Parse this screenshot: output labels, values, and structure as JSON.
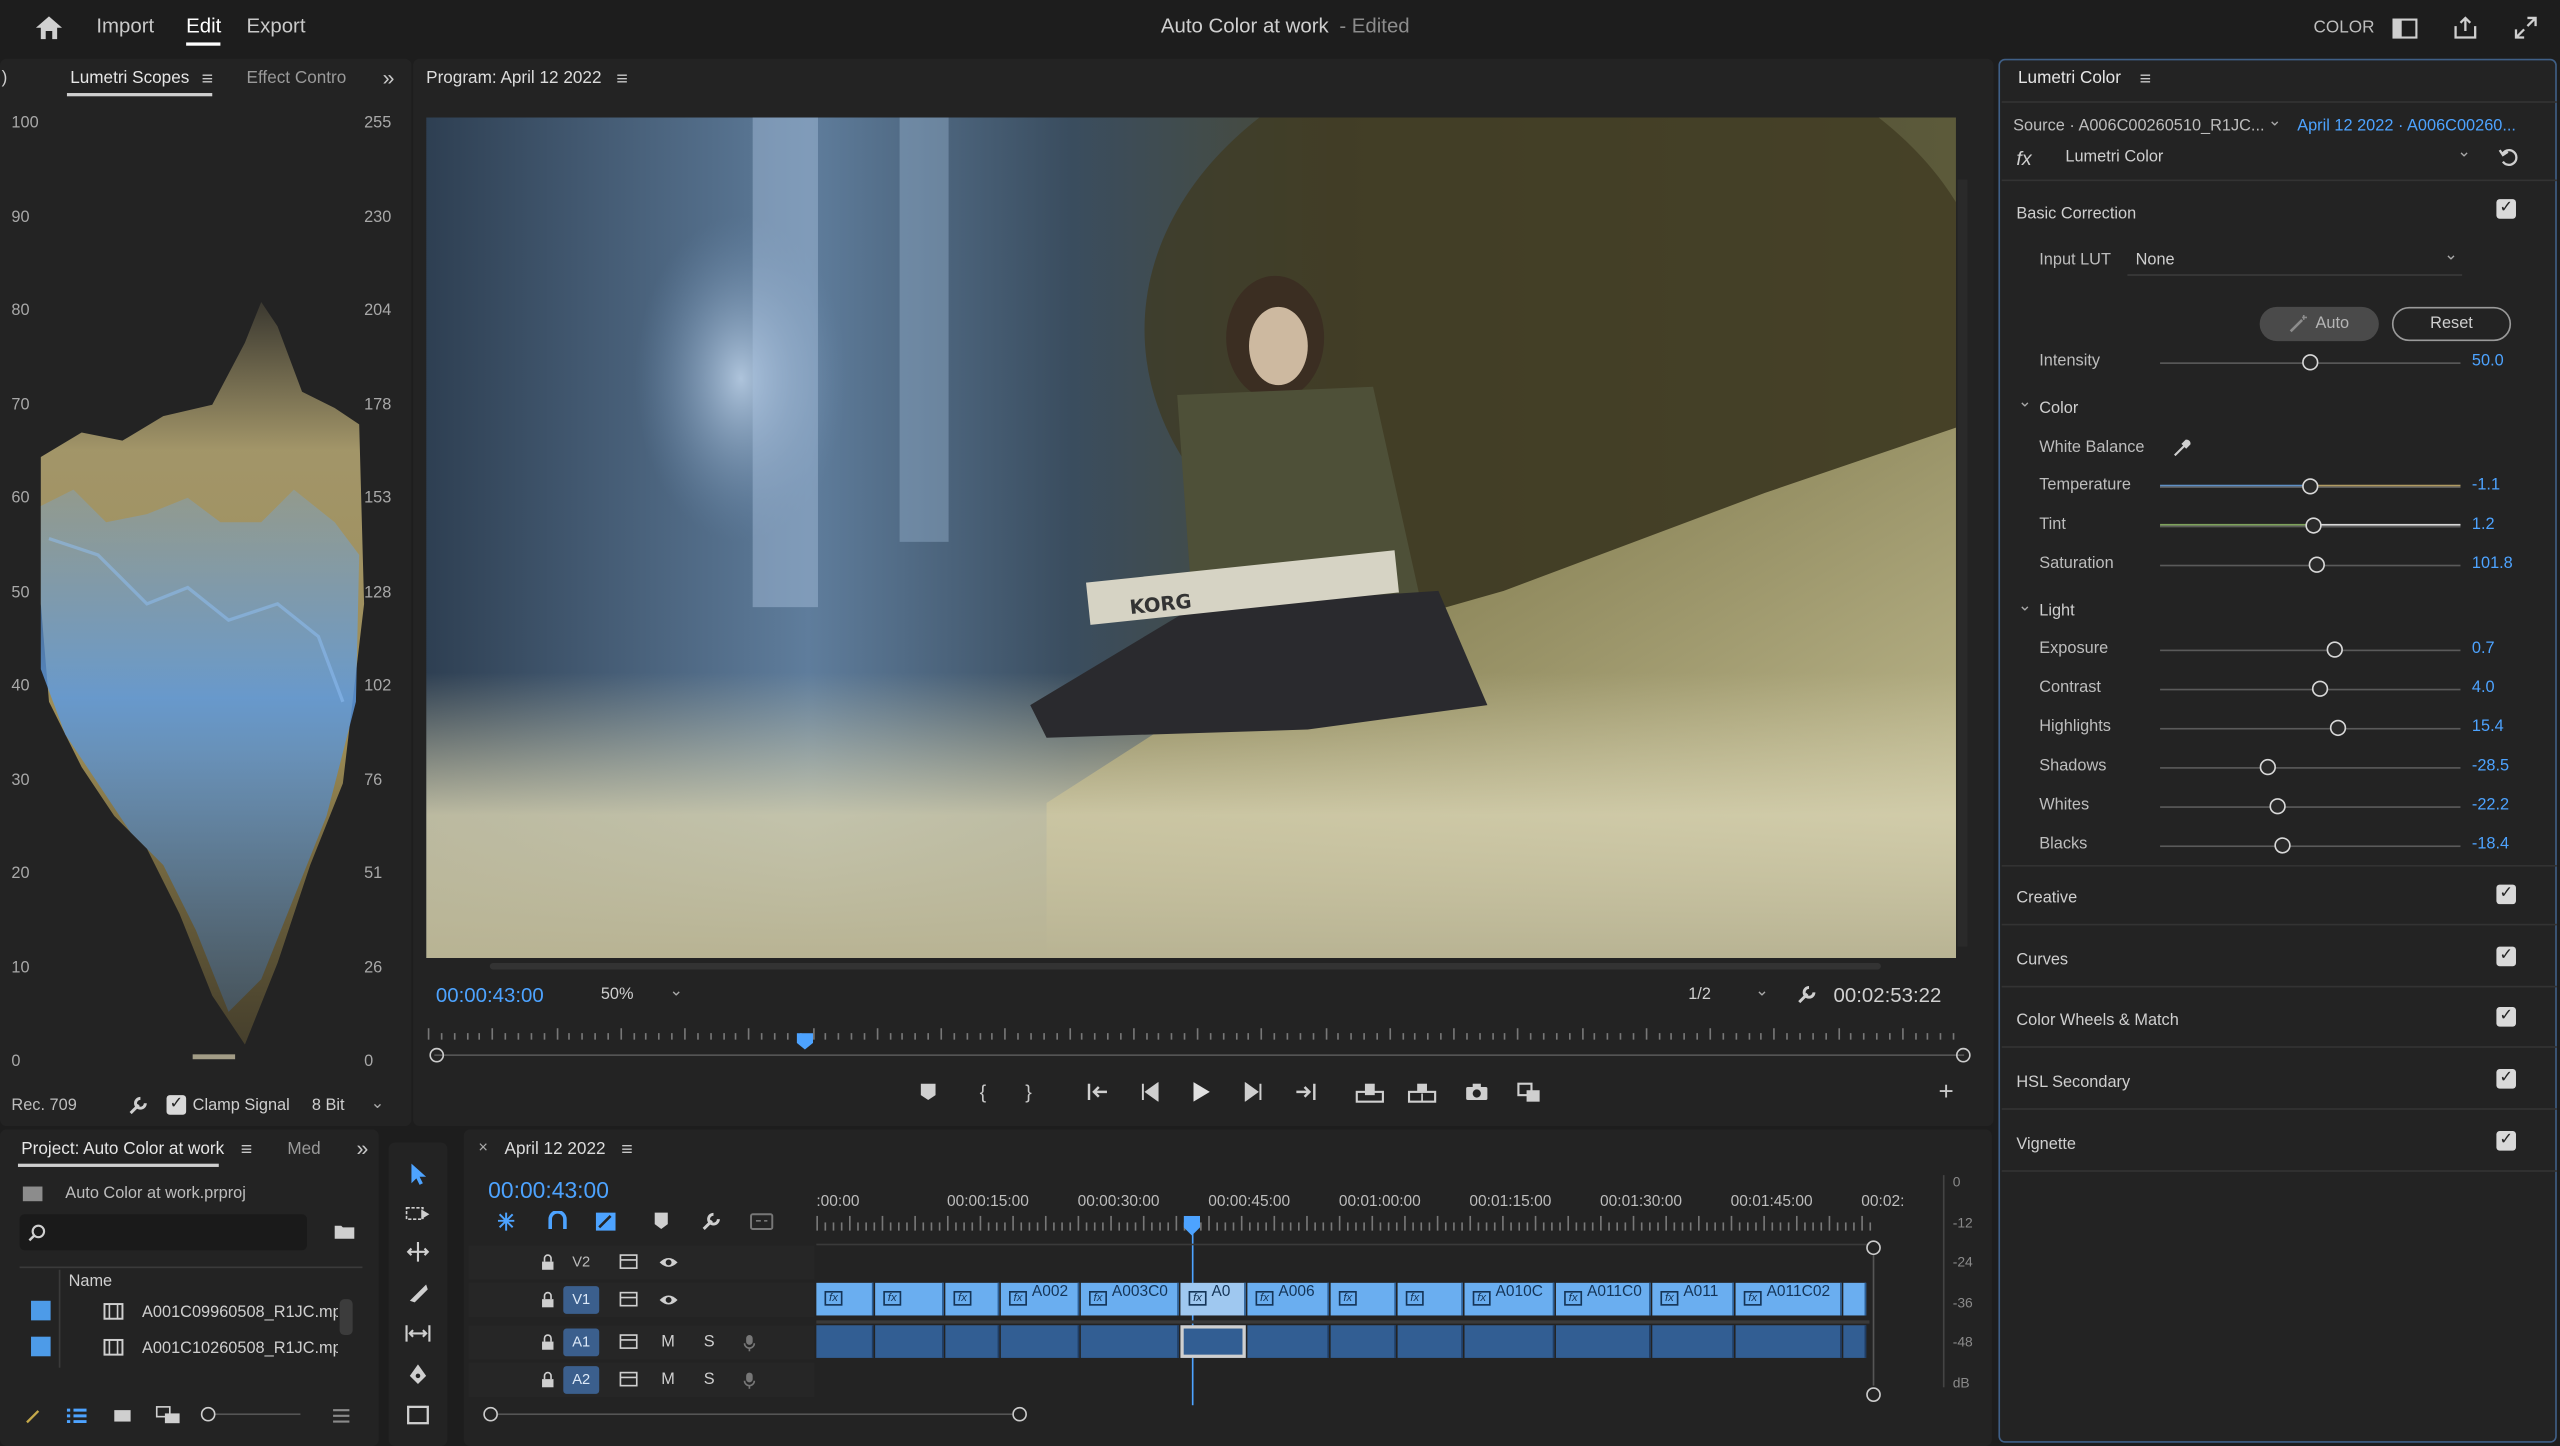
{
  "app": {
    "nav": [
      "Import",
      "Edit",
      "Export"
    ],
    "active_nav": "Edit",
    "project_title": "Auto Color at work",
    "edited_label": "- Edited",
    "workspace_label": "COLOR"
  },
  "left_panel": {
    "paren": ")",
    "tabs": [
      "Lumetri Scopes",
      "Effect Contro"
    ],
    "y_left": [
      "100",
      "90",
      "80",
      "70",
      "60",
      "50",
      "40",
      "30",
      "20",
      "10",
      "0"
    ],
    "y_right": [
      "255",
      "230",
      "204",
      "178",
      "153",
      "128",
      "102",
      "76",
      "51",
      "26",
      "0"
    ],
    "footer": {
      "colorspace": "Rec. 709",
      "clamp_label": "Clamp Signal",
      "clamp_checked": true,
      "bit_depth": "8 Bit"
    }
  },
  "program": {
    "tab_label": "Program: April 12 2022",
    "timecode": "00:00:43:00",
    "zoom": "50%",
    "resolution": "1/2",
    "duration": "00:02:53:22",
    "overlay_text": "KORG",
    "playhead_fraction": 0.247
  },
  "project_panel": {
    "tabs": [
      "Project: Auto Color at work",
      "Med"
    ],
    "file": "Auto Color at work.prproj",
    "column": "Name",
    "items": [
      "A001C09960508_R1JC.mp4",
      "A001C10260508_R1JC.mp4"
    ]
  },
  "timeline": {
    "tab_label": "April 12 2022",
    "timecode": "00:00:43:00",
    "ruler": [
      ":00:00",
      "00:00:15:00",
      "00:00:30:00",
      "00:00:45:00",
      "00:01:00:00",
      "00:01:15:00",
      "00:01:30:00",
      "00:01:45:00",
      "00:02:"
    ],
    "tracks": [
      {
        "name": "V2",
        "icons": [
          "lock-icon",
          "film-icon",
          "eye-icon"
        ]
      },
      {
        "name": "V1",
        "icons": [
          "lock-icon",
          "film-icon",
          "eye-icon"
        ]
      },
      {
        "name": "A1",
        "m": "M",
        "s": "S"
      },
      {
        "name": "A2",
        "m": "M",
        "s": "S"
      }
    ],
    "clip_labels": [
      "A002",
      "A003C0",
      "A0",
      "A006",
      "A010C",
      "A011C0",
      "A011",
      "A011C02"
    ],
    "meter_scale": [
      "0",
      "-12",
      "-24",
      "-36",
      "-48",
      "dB"
    ]
  },
  "lumetri": {
    "tab_label": "Lumetri Color",
    "source": "Source · A006C00260510_R1JC...",
    "sequence": "April 12 2022 · A006C00260...",
    "effect_name": "Lumetri Color",
    "basic_correction": {
      "title": "Basic Correction",
      "enabled": true,
      "input_lut_label": "Input LUT",
      "input_lut_value": "None",
      "auto_label": "Auto",
      "reset_label": "Reset",
      "intensity": {
        "label": "Intensity",
        "value": "50.0",
        "pos": 0.5
      },
      "color_section": "Color",
      "white_balance": "White Balance",
      "color_sliders": [
        {
          "label": "Temperature",
          "value": "-1.1",
          "pos": 0.5
        },
        {
          "label": "Tint",
          "value": "1.2",
          "pos": 0.51
        },
        {
          "label": "Saturation",
          "value": "101.8",
          "pos": 0.52
        }
      ],
      "light_section": "Light",
      "light_sliders": [
        {
          "label": "Exposure",
          "value": "0.7",
          "pos": 0.58
        },
        {
          "label": "Contrast",
          "value": "4.0",
          "pos": 0.53
        },
        {
          "label": "Highlights",
          "value": "15.4",
          "pos": 0.59
        },
        {
          "label": "Shadows",
          "value": "-28.5",
          "pos": 0.36
        },
        {
          "label": "Whites",
          "value": "-22.2",
          "pos": 0.39
        },
        {
          "label": "Blacks",
          "value": "-18.4",
          "pos": 0.41
        }
      ]
    },
    "sections": [
      {
        "label": "Creative",
        "enabled": true
      },
      {
        "label": "Curves",
        "enabled": true
      },
      {
        "label": "Color Wheels & Match",
        "enabled": true
      },
      {
        "label": "HSL Secondary",
        "enabled": true
      },
      {
        "label": "Vignette",
        "enabled": true
      }
    ]
  },
  "colors": {
    "accent": "#4da3ff",
    "clip_video": "#6aaef0",
    "clip_audio": "#325e93"
  }
}
